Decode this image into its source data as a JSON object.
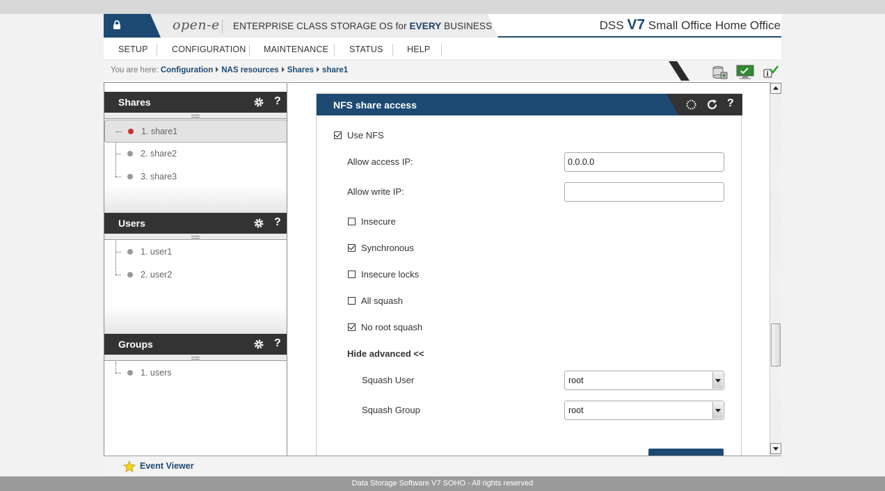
{
  "header": {
    "logo": "open-e",
    "tagline_pre": "ENTERPRISE CLASS STORAGE OS for ",
    "tagline_bold": "EVERY",
    "tagline_post": " BUSINESS",
    "product_dss": "DSS",
    "product_v7": "V7",
    "product_edition": "Small Office Home Office"
  },
  "menu": {
    "items": [
      "SETUP",
      "CONFIGURATION",
      "MAINTENANCE",
      "STATUS",
      "HELP"
    ]
  },
  "breadcrumb": {
    "prefix": "You are here:",
    "items": [
      "Configuration",
      "NAS resources",
      "Shares",
      "share1"
    ]
  },
  "left": {
    "shares": {
      "title": "Shares",
      "help": "?",
      "items": [
        "1. share1",
        "2. share2",
        "3. share3"
      ]
    },
    "users": {
      "title": "Users",
      "help": "?",
      "items": [
        "1. user1",
        "2. user2"
      ]
    },
    "groups": {
      "title": "Groups",
      "help": "?",
      "items": [
        "1. users"
      ]
    }
  },
  "nfs": {
    "title": "NFS share access",
    "help": "?",
    "use_nfs": {
      "label": "Use NFS",
      "checked": true
    },
    "allow_access_ip": {
      "label": "Allow access IP:",
      "value": "0.0.0.0"
    },
    "allow_write_ip": {
      "label": "Allow write IP:",
      "value": ""
    },
    "insecure": {
      "label": "Insecure",
      "checked": false
    },
    "synchronous": {
      "label": "Synchronous",
      "checked": true
    },
    "insecure_locks": {
      "label": "Insecure locks",
      "checked": false
    },
    "all_squash": {
      "label": "All squash",
      "checked": false
    },
    "no_root_squash": {
      "label": "No root squash",
      "checked": true
    },
    "hide_advanced": "Hide advanced <<",
    "squash_user": {
      "label": "Squash User",
      "value": "root"
    },
    "squash_group": {
      "label": "Squash Group",
      "value": "root"
    }
  },
  "event_viewer": "Event Viewer",
  "footer": "Data Storage Software V7 SOHO - All rights reserved",
  "colors": {
    "brand_blue": "#1d4a72",
    "panel_dark": "#333333",
    "selected_dot": "#c9302c"
  }
}
